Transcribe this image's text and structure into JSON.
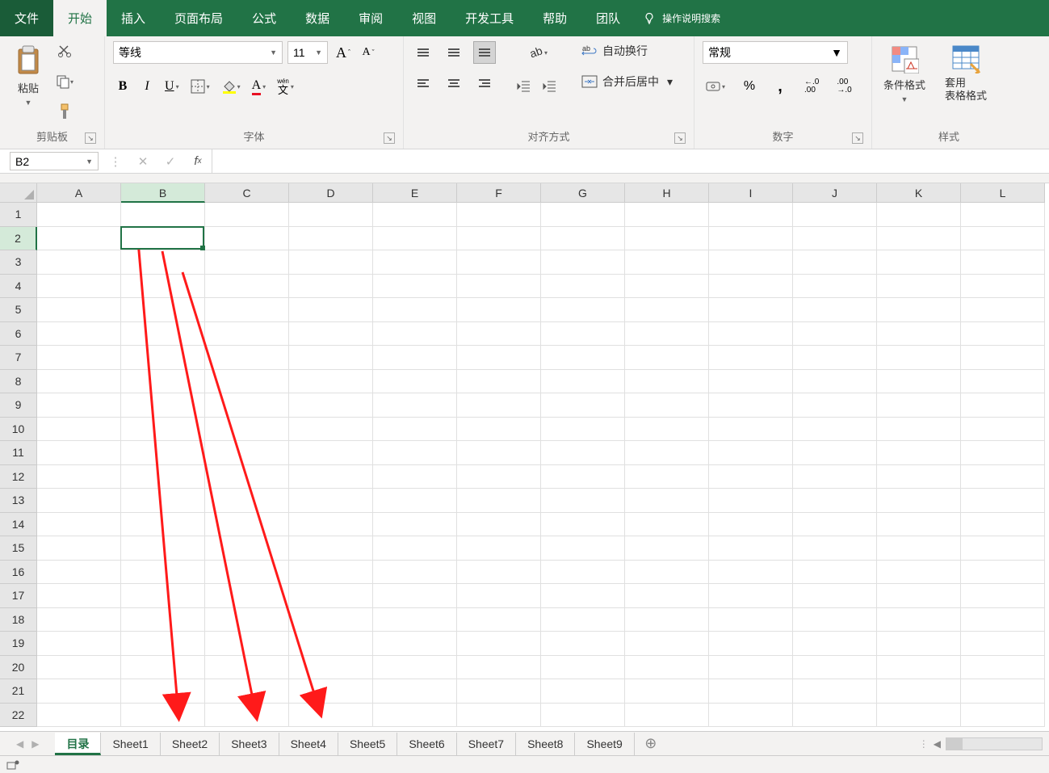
{
  "ribbon": {
    "tabs": [
      "文件",
      "开始",
      "插入",
      "页面布局",
      "公式",
      "数据",
      "审阅",
      "视图",
      "开发工具",
      "帮助",
      "团队"
    ],
    "active_index": 1,
    "search_placeholder": "操作说明搜索"
  },
  "groups": {
    "clipboard": {
      "paste": "粘贴",
      "label": "剪贴板"
    },
    "font": {
      "name": "等线",
      "size": "11",
      "wen": "wén",
      "wenchar": "文",
      "label": "字体"
    },
    "alignment": {
      "label": "对齐方式",
      "wrap": "自动换行",
      "merge": "合并后居中"
    },
    "number": {
      "format": "常规",
      "label": "数字"
    },
    "styles": {
      "conditional": "条件格式",
      "table": "套用",
      "table2": "表格格式",
      "label": "样式"
    }
  },
  "namebox": "B2",
  "columns": [
    "A",
    "B",
    "C",
    "D",
    "E",
    "F",
    "G",
    "H",
    "I",
    "J",
    "K",
    "L"
  ],
  "rows": [
    "1",
    "2",
    "3",
    "4",
    "5",
    "6",
    "7",
    "8",
    "9",
    "10",
    "11",
    "12",
    "13",
    "14",
    "15",
    "16",
    "17",
    "18",
    "19",
    "20",
    "21",
    "22"
  ],
  "selected": {
    "col_index": 1,
    "row_index": 1
  },
  "sheets": {
    "active": "目录",
    "tabs": [
      "目录",
      "Sheet1",
      "Sheet2",
      "Sheet3",
      "Sheet4",
      "Sheet5",
      "Sheet6",
      "Sheet7",
      "Sheet8",
      "Sheet9"
    ]
  }
}
